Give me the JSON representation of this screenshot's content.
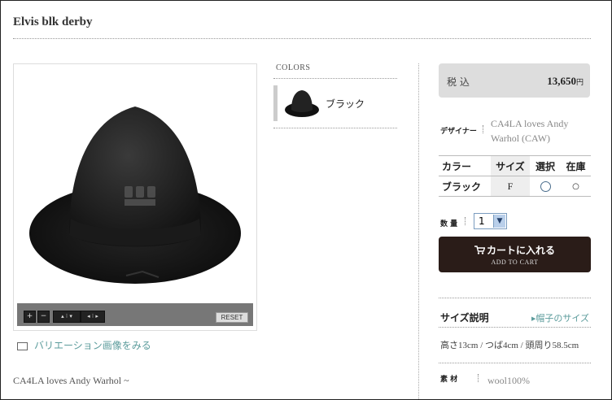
{
  "product": {
    "title": "Elvis blk derby",
    "variation_link": "バリエーション画像をみる",
    "intro": "CA4LA loves Andy Warhol ~"
  },
  "viewer": {
    "reset_label": "RESET",
    "zoom_in": "+",
    "zoom_out": "−",
    "nav_vertical": "▴ ⁝ ▾",
    "nav_horizontal": "◂ ⁝ ▸"
  },
  "colors": {
    "label": "COLORS",
    "items": [
      {
        "name": "ブラック"
      }
    ]
  },
  "price": {
    "tax_label": "税 込",
    "value": "13,650",
    "unit": "円"
  },
  "designer": {
    "label": "デザイナー",
    "value": "CA4LA loves Andy Warhol (CAW)"
  },
  "stock_table": {
    "headers": [
      "カラー",
      "サイズ",
      "選択",
      "在庫"
    ],
    "rows": [
      {
        "color": "ブラック",
        "size": "F",
        "stock": "○"
      }
    ]
  },
  "quantity": {
    "label": "数 量",
    "value": "1"
  },
  "cart": {
    "label": "カートに入れる",
    "sub": "ADD TO CART"
  },
  "size_info": {
    "heading": "サイズ説明",
    "link": "帽子のサイズ",
    "value": "高さ13cm / つば4cm / 頭周り58.5cm"
  },
  "material": {
    "label": "素 材",
    "value": "wool100%"
  },
  "icons": {
    "cart": "cart-icon",
    "variation": "windows-icon",
    "link_arrow": "triangle-right-icon"
  },
  "colors_theme": {
    "accent": "#5c9c9c",
    "cart_bg": "#2a1c18",
    "price_bg": "#dddddd"
  }
}
